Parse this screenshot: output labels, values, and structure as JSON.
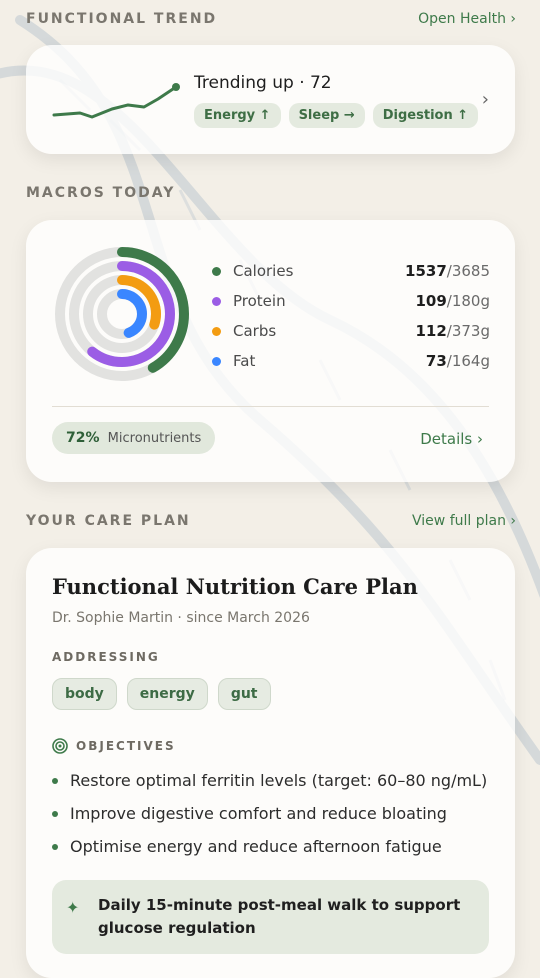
{
  "trend_section": {
    "title": "FUNCTIONAL TREND",
    "link": "Open Health ›",
    "headline": "Trending up · 72",
    "chips": [
      "Energy ↑",
      "Sleep →",
      "Digestion ↑"
    ],
    "chevron": "›"
  },
  "macros_section": {
    "title": "MACROS TODAY",
    "items": [
      {
        "name": "Calories",
        "value": "1537",
        "target": "/3685",
        "color": "#3e7a4a"
      },
      {
        "name": "Protein",
        "value": "109",
        "target": "/180g",
        "color": "#9b5de5"
      },
      {
        "name": "Carbs",
        "value": "112",
        "target": "/373g",
        "color": "#f39c12"
      },
      {
        "name": "Fat",
        "value": "73",
        "target": "/164g",
        "color": "#3a86ff"
      }
    ],
    "micronutrients_pct": "72%",
    "micronutrients_label": "Micronutrients",
    "details_link": "Details ›"
  },
  "care_plan_section": {
    "title": "YOUR CARE PLAN",
    "link": "View full plan ›",
    "plan_title": "Functional Nutrition Care Plan",
    "plan_sub": "Dr. Sophie Martin · since March 2026",
    "addressing_label": "ADDRESSING",
    "tags": [
      "body",
      "energy",
      "gut"
    ],
    "objectives_label": "OBJECTIVES",
    "objectives": [
      "Restore optimal ferritin levels (target: 60–80 ng/mL)",
      "Improve digestive comfort and reduce bloating",
      "Optimise energy and reduce afternoon fatigue"
    ],
    "tip_line1": "Daily 15-minute post-meal walk to support",
    "tip_line2": "glucose regulation"
  },
  "colors": {
    "accent": "#3e7a4a",
    "chip_bg": "#e4eadf",
    "bg": "#f3efe7"
  }
}
